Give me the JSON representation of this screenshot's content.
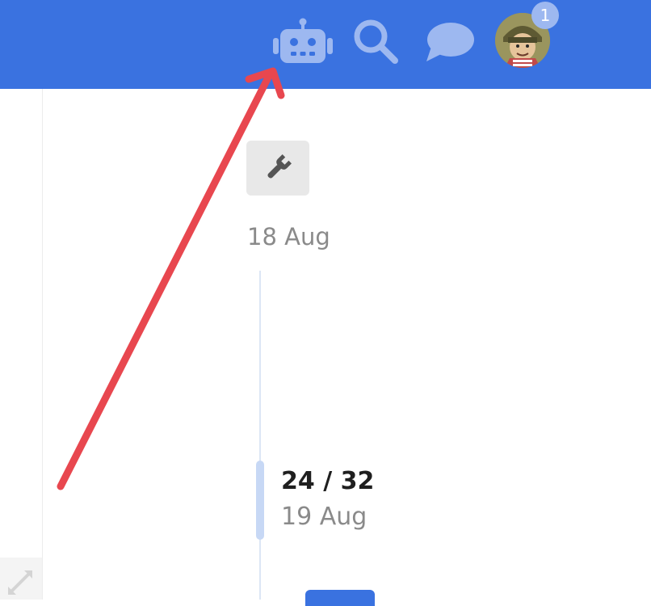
{
  "header": {
    "background": "#3a72e0",
    "icons": [
      "robot-icon",
      "search-icon",
      "chat-bubble-icon"
    ],
    "notification_count": "1",
    "avatar": "user-avatar"
  },
  "timeline": {
    "top_date": "18 Aug",
    "position": "24 / 32",
    "current_date": "19 Aug",
    "tool_icon": "wrench-icon"
  },
  "annotation": {
    "color": "#e8474f",
    "type": "arrow"
  }
}
